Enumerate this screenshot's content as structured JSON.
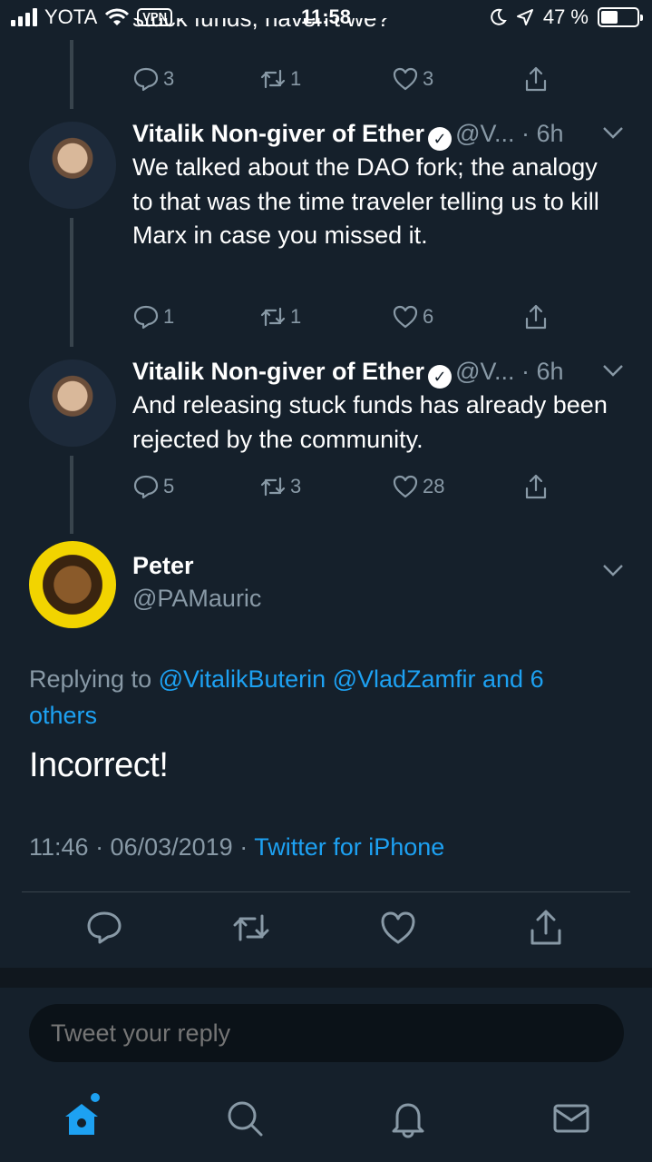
{
  "status_bar": {
    "carrier": "YOTA",
    "vpn": "VPN",
    "time": "11:58",
    "battery": "47 %",
    "battery_level": 0.47
  },
  "prev_tweet_cut_text": "stuck funds, haven't we?",
  "tweets": [
    {
      "replies": "3",
      "retweets": "1",
      "likes": "3"
    },
    {
      "name": "Vitalik Non-giver of Ether",
      "meta": "@V... · 6h",
      "text": "We talked about the DAO fork; the analogy to that was the time traveler telling us to kill Marx in case you missed it.",
      "replies": "1",
      "retweets": "1",
      "likes": "6"
    },
    {
      "name": "Vitalik Non-giver of Ether",
      "meta": "@V... · 6h",
      "text": "And releasing stuck funds has already been rejected by the community.",
      "replies": "5",
      "retweets": "3",
      "likes": "28"
    }
  ],
  "focused": {
    "name": "Peter",
    "handle": "@PAMauric",
    "replying_prefix": "Replying to ",
    "replying_to": "@VitalikButerin @VladZamfir and 6 others",
    "text": "Incorrect!",
    "time": "11:46 · 06/03/2019 · ",
    "source": "Twitter for iPhone"
  },
  "reply_placeholder": "Tweet your reply",
  "icons": {
    "reply": "reply-icon",
    "retweet": "retweet-icon",
    "like": "heart-icon",
    "share": "share-icon",
    "home": "home-icon",
    "search": "search-icon",
    "notifications": "bell-icon",
    "messages": "mail-icon"
  },
  "colors": {
    "background": "#15202b",
    "accent": "#1da1f2",
    "muted": "#8899a6"
  }
}
